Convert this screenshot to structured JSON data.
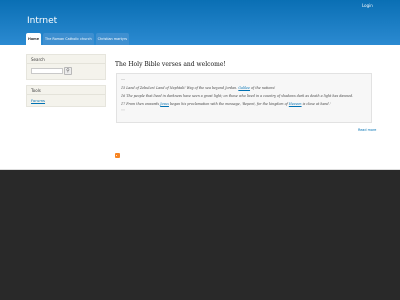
{
  "header": {
    "site_name": "Intrnet",
    "login": "Login"
  },
  "tabs": [
    {
      "label": "Home",
      "active": true
    },
    {
      "label": "The Roman Catholic church",
      "active": false
    },
    {
      "label": "Christian martyrs",
      "active": false
    }
  ],
  "sidebar": {
    "search": {
      "title": "Search",
      "placeholder": "",
      "button_icon": "search-icon"
    },
    "tools": {
      "title": "Tools",
      "links": [
        "Forums"
      ]
    }
  },
  "content": {
    "title": "The Holy Bible verses and welcome!",
    "quote_open": "““",
    "quote_close": "””",
    "verses": [
      {
        "pre": "15 Land of Zebulun! Land of Naphtali! Way of the sea beyond Jordan. ",
        "link": "Galilee",
        "post": " of the nations!"
      },
      {
        "pre": "16 The people that lived in darkness have seen a great light; on those who lived in a country of shadows dark as death a light has dawned.",
        "link": "",
        "post": ""
      },
      {
        "pre": "17 From then onwards ",
        "link": "Jesus",
        "post": " began his proclamation with the message, 'Repent, for the kingdom of "
      },
      {
        "pre": "",
        "link": "",
        "post": ""
      }
    ],
    "verse3_link2": "Heaven",
    "verse3_tail": " is close at hand.'",
    "read_more": "Read more"
  },
  "colors": {
    "header_top": "#0a6fb4",
    "header_bottom": "#2b8ad1",
    "link": "#0071b3",
    "rss": "#f78422",
    "footer": "#292929"
  }
}
